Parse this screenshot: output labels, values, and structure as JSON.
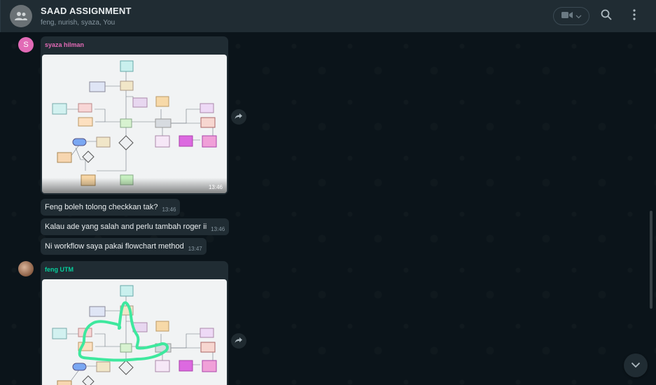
{
  "header": {
    "title": "SAAD ASSIGNMENT",
    "members": "feng, nurish, syaza, You",
    "icons": [
      "group-avatar-icon",
      "video-call-icon",
      "chevron-down-icon",
      "search-icon",
      "menu-icon"
    ]
  },
  "messages": [
    {
      "sender": "syaza hilman",
      "sender_initial": "S",
      "sender_color": "#e26ab6",
      "type": "image",
      "image_description": "flowchart diagram",
      "time": "13:46"
    },
    {
      "type": "text",
      "text": "Feng boleh tolong checkkan tak?",
      "time": "13:46"
    },
    {
      "type": "text",
      "text": "Kalau ade yang salah and perlu tambah roger ii",
      "time": "13:46"
    },
    {
      "type": "text",
      "text": "Ni workflow saya pakai flowchart method",
      "time": "13:47"
    },
    {
      "sender": "feng UTM",
      "sender_color": "#06cf9c",
      "type": "image",
      "image_description": "flowchart diagram with green hand-drawn annotation"
    }
  ],
  "colors": {
    "header_bg": "#202c33",
    "chat_bg": "#0b141a",
    "bubble_bg": "#202c33",
    "annotation": "#3ee89e"
  }
}
